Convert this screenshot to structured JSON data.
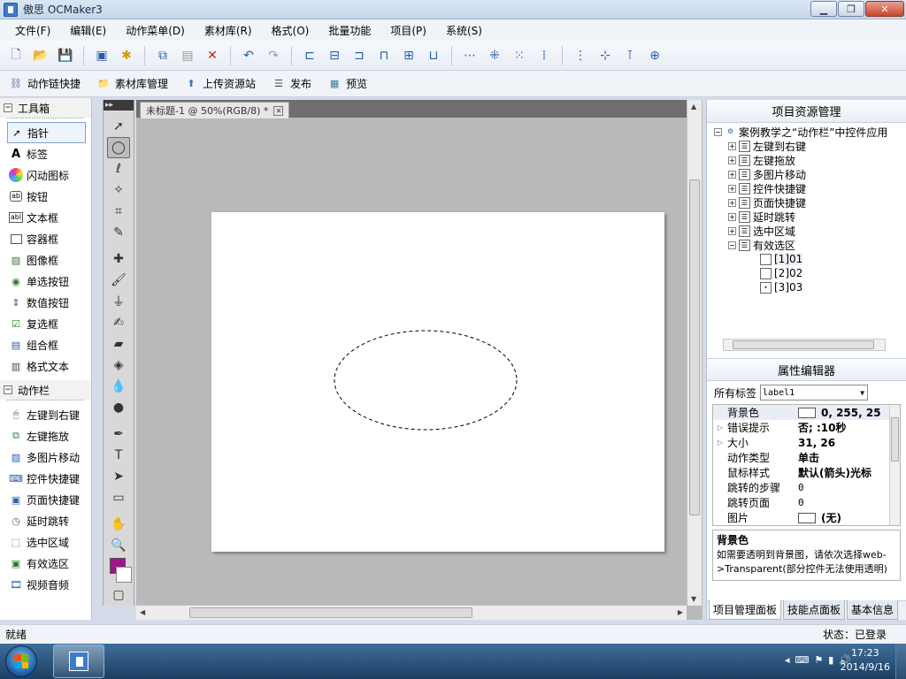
{
  "window": {
    "title": "傲思 OCMaker3"
  },
  "menu": [
    "文件(F)",
    "编辑(E)",
    "动作菜单(D)",
    "素材库(R)",
    "格式(O)",
    "批量功能",
    "项目(P)",
    "系统(S)"
  ],
  "toolbar2": [
    {
      "label": "动作链快捷",
      "icon": "chain-icon"
    },
    {
      "label": "素材库管理",
      "icon": "folder-icon"
    },
    {
      "label": "上传资源站",
      "icon": "upload-icon"
    },
    {
      "label": "发布",
      "icon": "publish-icon"
    },
    {
      "label": "预览",
      "icon": "preview-icon"
    }
  ],
  "toolbox": {
    "title": "工具箱",
    "items": [
      "指针",
      "标签",
      "闪动图标",
      "按钮",
      "文本框",
      "容器框",
      "图像框",
      "单选按钮",
      "数值按钮",
      "复选框",
      "组合框",
      "格式文本"
    ],
    "icon_text": {
      "label": "A",
      "button": "ab",
      "textbox": "abl"
    }
  },
  "actionbar": {
    "title": "动作栏",
    "items": [
      "左键到右键",
      "左键拖放",
      "多图片移动",
      "控件快捷键",
      "页面快捷键",
      "延时跳转",
      "选中区域",
      "有效选区",
      "视频音频"
    ]
  },
  "document": {
    "tab_title": "未标题-1 @ 50%(RGB/8) *",
    "fg_color": "#a0148c",
    "bg_color": "#ffffff"
  },
  "project": {
    "title": "项目资源管理",
    "root": "案例教学之“动作栏”中控件应用",
    "children": [
      "左键到右键",
      "左键拖放",
      "多图片移动",
      "控件快捷键",
      "页面快捷键",
      "延时跳转",
      "选中区域",
      "有效选区"
    ],
    "leaves": [
      "[1]01",
      "[2]02",
      "[3]03"
    ]
  },
  "properties": {
    "title": "属性编辑器",
    "all_tags_label": "所有标签",
    "selected": "label1",
    "rows": [
      {
        "name": "背景色",
        "value": "0, 255, 25"
      },
      {
        "name": "错误提示",
        "value": "否; :10秒"
      },
      {
        "name": "大小",
        "value": "31, 26"
      },
      {
        "name": "动作类型",
        "value": "单击"
      },
      {
        "name": "鼠标样式",
        "value": "默认(箭头)光标"
      },
      {
        "name": "跳转的步骤",
        "value": "0"
      },
      {
        "name": "跳转页面",
        "value": "0"
      },
      {
        "name": "图片",
        "value": "(无)"
      }
    ],
    "desc_title": "背景色",
    "desc_text": "如需要透明到背景图，请依次选择web->Transparent(部分控件无法使用透明)"
  },
  "bottom_tabs": [
    "项目管理面板",
    "技能点面板",
    "基本信息"
  ],
  "status": {
    "left": "就绪",
    "right": "状态：已登录"
  },
  "taskbar": {
    "time": "17:23",
    "date": "2014/9/16"
  }
}
